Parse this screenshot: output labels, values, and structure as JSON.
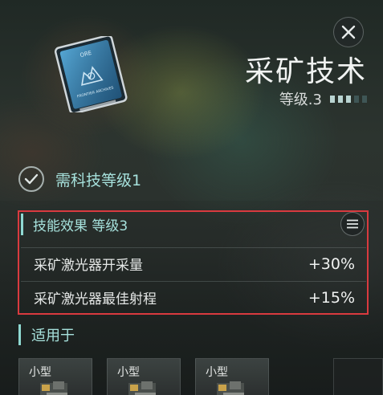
{
  "header": {
    "title": "采矿技术",
    "level_label": "等级.3",
    "level_current": 3,
    "level_max": 5
  },
  "card": {
    "brand_text": "ORE",
    "footer_text": "FRONTIER ARCHIVES"
  },
  "requirement": {
    "text": "需科技等级1"
  },
  "effects": {
    "header": "技能效果 等级3",
    "rows": [
      {
        "name": "采矿激光器开采量",
        "value": "+30%"
      },
      {
        "name": "采矿激光器最佳射程",
        "value": "+15%"
      }
    ]
  },
  "applies": {
    "title": "适用于",
    "ships": [
      {
        "label": "小型"
      },
      {
        "label": "小型"
      },
      {
        "label": "小型"
      }
    ]
  },
  "colors": {
    "accent": "#a6e1dc",
    "highlight_border": "#d93a3f"
  }
}
